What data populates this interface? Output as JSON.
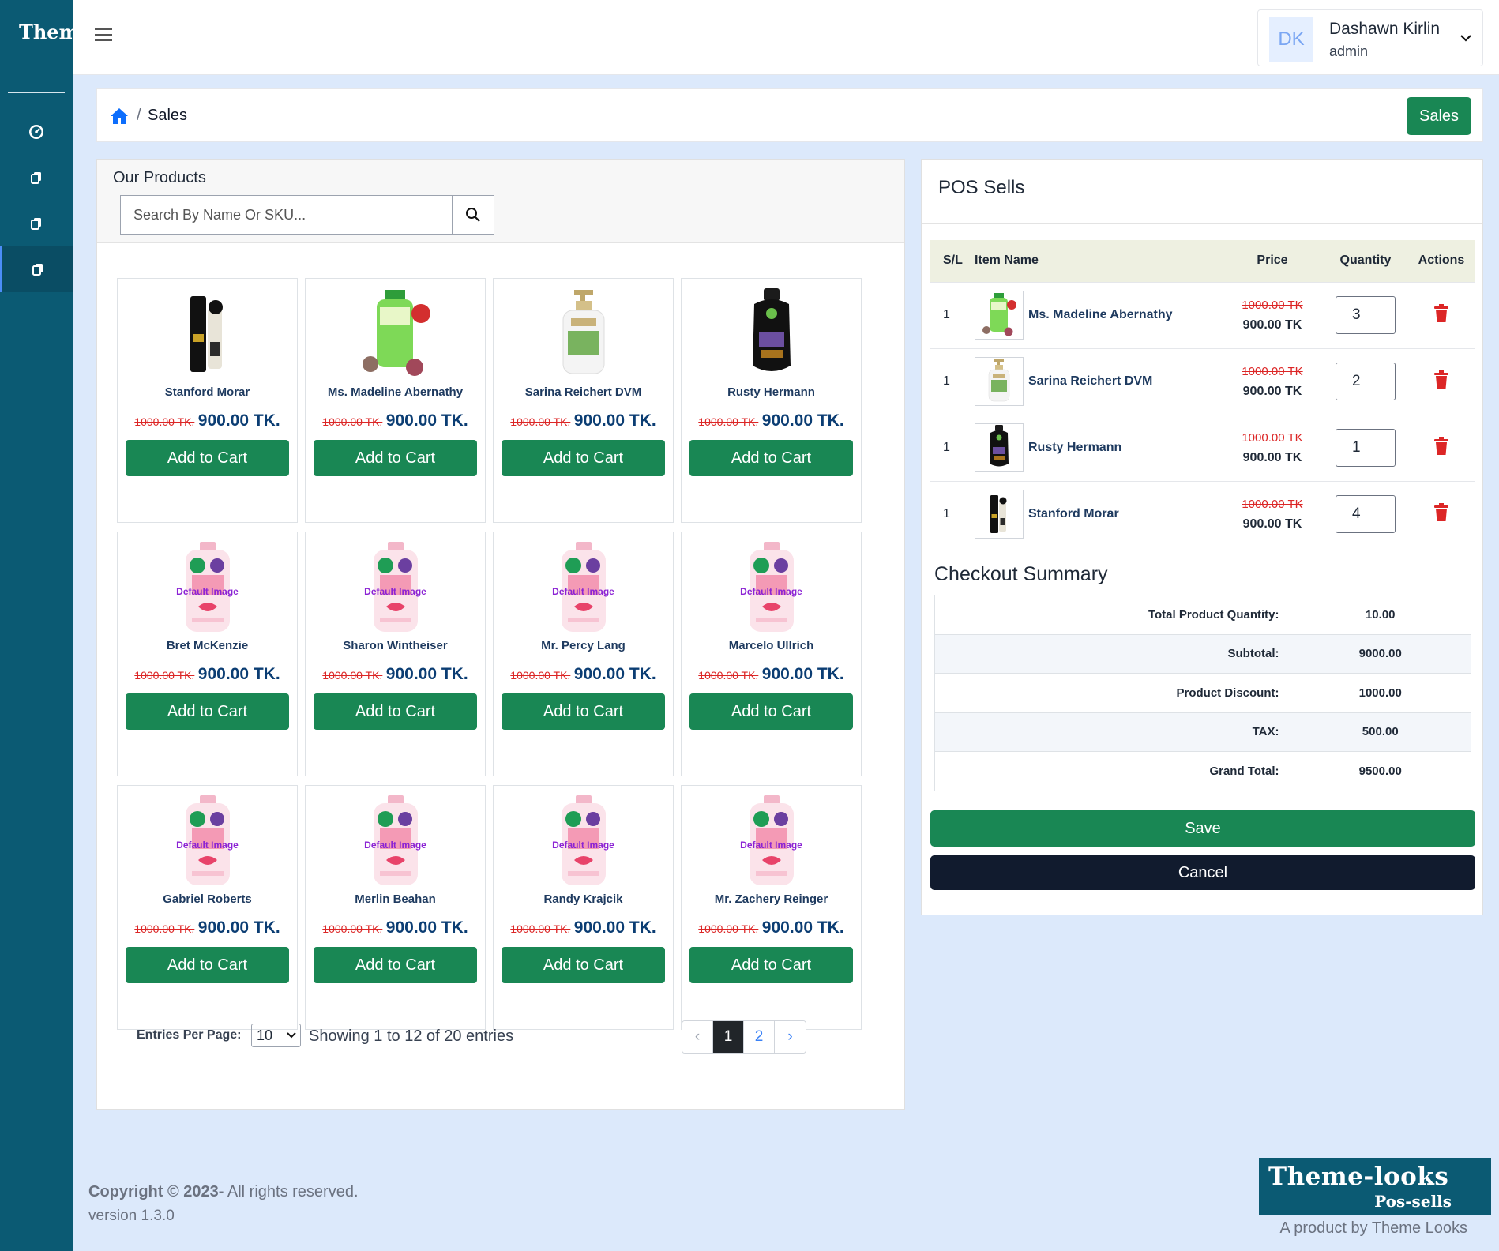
{
  "brand": "Them",
  "sidebar": {
    "items": [
      {
        "icon": "dashboard-icon"
      },
      {
        "icon": "copy-icon"
      },
      {
        "icon": "copy-icon"
      },
      {
        "icon": "copy-icon",
        "active": true
      }
    ]
  },
  "header": {
    "user_initials": "DK",
    "user_name": "Dashawn Kirlin",
    "user_role": "admin"
  },
  "breadcrumb": {
    "current": "Sales",
    "separator": "/",
    "button_label": "Sales"
  },
  "products": {
    "title": "Our Products",
    "search_placeholder": "Search By Name Or SKU...",
    "add_label": "Add to Cart",
    "items": [
      {
        "name": "Stanford Morar",
        "old_price": "1000.00 TK.",
        "price": "900.00 TK.",
        "image": "black-tube"
      },
      {
        "name": "Ms. Madeline Abernathy",
        "old_price": "1000.00 TK.",
        "price": "900.00 TK.",
        "image": "green-bottle"
      },
      {
        "name": "Sarina Reichert DVM",
        "old_price": "1000.00 TK.",
        "price": "900.00 TK.",
        "image": "white-pump"
      },
      {
        "name": "Rusty Hermann",
        "old_price": "1000.00 TK.",
        "price": "900.00 TK.",
        "image": "black-bottle"
      },
      {
        "name": "Bret McKenzie",
        "old_price": "1000.00 TK.",
        "price": "900.00 TK.",
        "image": "default",
        "default_label": "Default Image"
      },
      {
        "name": "Sharon Wintheiser",
        "old_price": "1000.00 TK.",
        "price": "900.00 TK.",
        "image": "default",
        "default_label": "Default Image"
      },
      {
        "name": "Mr. Percy Lang",
        "old_price": "1000.00 TK.",
        "price": "900.00 TK.",
        "image": "default",
        "default_label": "Default Image"
      },
      {
        "name": "Marcelo Ullrich",
        "old_price": "1000.00 TK.",
        "price": "900.00 TK.",
        "image": "default",
        "default_label": "Default Image"
      },
      {
        "name": "Gabriel Roberts",
        "old_price": "1000.00 TK.",
        "price": "900.00 TK.",
        "image": "default",
        "default_label": "Default Image"
      },
      {
        "name": "Merlin Beahan",
        "old_price": "1000.00 TK.",
        "price": "900.00 TK.",
        "image": "default",
        "default_label": "Default Image"
      },
      {
        "name": "Randy Krajcik",
        "old_price": "1000.00 TK.",
        "price": "900.00 TK.",
        "image": "default",
        "default_label": "Default Image"
      },
      {
        "name": "Mr. Zachery Reinger",
        "old_price": "1000.00 TK.",
        "price": "900.00 TK.",
        "image": "default",
        "default_label": "Default Image"
      }
    ],
    "entries_label": "Entries Per Page:",
    "entries_value": "10",
    "showing_text": "Showing 1 to 12 of 20 entries",
    "pagination": {
      "prev": "‹",
      "pages": [
        "1",
        "2"
      ],
      "current": "1",
      "next": "›"
    }
  },
  "pos": {
    "title": "POS Sells",
    "columns": [
      "S/L",
      "Item Name",
      "Price",
      "Quantity",
      "Actions"
    ],
    "rows": [
      {
        "sl": "1",
        "name": "Ms. Madeline Abernathy",
        "old_price": "1000.00 TK",
        "price": "900.00 TK",
        "qty": "3",
        "image": "green-bottle",
        "action_icon": "trash-icon"
      },
      {
        "sl": "1",
        "name": "Sarina Reichert DVM",
        "old_price": "1000.00 TK",
        "price": "900.00 TK",
        "qty": "2",
        "image": "white-pump",
        "action_icon": "trash-icon"
      },
      {
        "sl": "1",
        "name": "Rusty Hermann",
        "old_price": "1000.00 TK",
        "price": "900.00 TK",
        "qty": "1",
        "image": "black-bottle",
        "action_icon": "trash-icon"
      },
      {
        "sl": "1",
        "name": "Stanford Morar",
        "old_price": "1000.00 TK",
        "price": "900.00 TK",
        "qty": "4",
        "image": "black-tube",
        "action_icon": "trash-icon"
      }
    ],
    "summary_title": "Checkout Summary",
    "summary": [
      {
        "label": "Total Product Quantity:",
        "value": "10.00"
      },
      {
        "label": "Subtotal:",
        "value": "9000.00"
      },
      {
        "label": "Product Discount:",
        "value": "1000.00"
      },
      {
        "label": "TAX:",
        "value": "500.00"
      },
      {
        "label": "Grand Total:",
        "value": "9500.00"
      }
    ],
    "save_label": "Save",
    "cancel_label": "Cancel"
  },
  "footer": {
    "copyright_bold": "Copyright © 2023-",
    "copyright_rest": " All rights reserved.",
    "version": "version 1.3.0",
    "logo_line1": "Theme-looks",
    "logo_line2": "Pos-sells",
    "tagline": "A product by Theme Looks"
  },
  "colors": {
    "sidebar": "#0b5a73",
    "primary_green": "#198754",
    "danger": "#dc2626",
    "page_bg": "#dce9fb",
    "price_blue": "#0b3d73"
  }
}
